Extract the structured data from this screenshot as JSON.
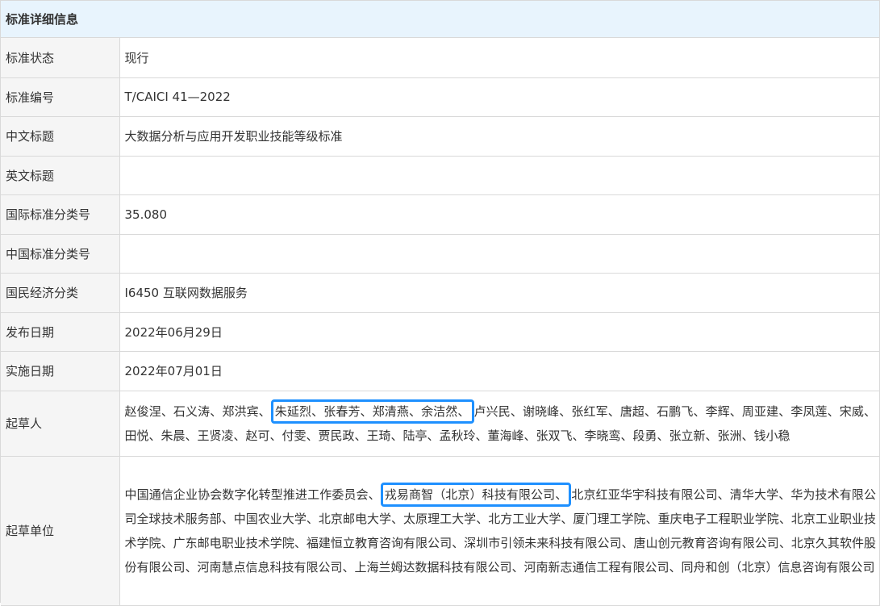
{
  "header": {
    "title": "标准详细信息"
  },
  "rows": [
    {
      "label": "标准状态",
      "value": "现行"
    },
    {
      "label": "标准编号",
      "value": "T/CAICI 41—2022"
    },
    {
      "label": "中文标题",
      "value": "大数据分析与应用开发职业技能等级标准"
    },
    {
      "label": "英文标题",
      "value": ""
    },
    {
      "label": "国际标准分类号",
      "value": "35.080"
    },
    {
      "label": "中国标准分类号",
      "value": ""
    },
    {
      "label": "国民经济分类",
      "value": "I6450 互联网数据服务"
    },
    {
      "label": "发布日期",
      "value": "2022年06月29日"
    },
    {
      "label": "实施日期",
      "value": "2022年07月01日"
    }
  ],
  "drafters": {
    "label": "起草人",
    "before": "赵俊涅、石义涛、郑洪宾、",
    "highlight": "朱延烈、张春芳、郑清燕、余洁然、",
    "after": "卢兴民、谢晓峰、张红军、唐超、石鹏飞、李辉、周亚建、李凤莲、宋威、田悦、朱晨、王贤凌、赵可、付雯、贾民政、王琦、陆亭、孟秋玲、董海峰、张双飞、李晓鸾、段勇、张立新、张洲、钱小稳"
  },
  "units": {
    "label": "起草单位",
    "before": "中国通信企业协会数字化转型推进工作委员会、",
    "highlight": "戎易商智（北京）科技有限公司、",
    "after": "北京红亚华宇科技有限公司、清华大学、华为技术有限公司全球技术服务部、中国农业大学、北京邮电大学、太原理工大学、北方工业大学、厦门理工学院、重庆电子工程职业学院、北京工业职业技术学院、广东邮电职业技术学院、福建恒立教育咨询有限公司、深圳市引领未来科技有限公司、唐山创元教育咨询有限公司、北京久其软件股份有限公司、河南慧点信息科技有限公司、上海兰姆达数据科技有限公司、河南新志通信工程有限公司、同舟和创（北京）信息咨询有限公司"
  },
  "colors": {
    "header_bg": "#e8f4fd",
    "label_bg": "#f5f5f5",
    "border": "#d9d9d9",
    "highlight_box": "#1e90ff"
  }
}
